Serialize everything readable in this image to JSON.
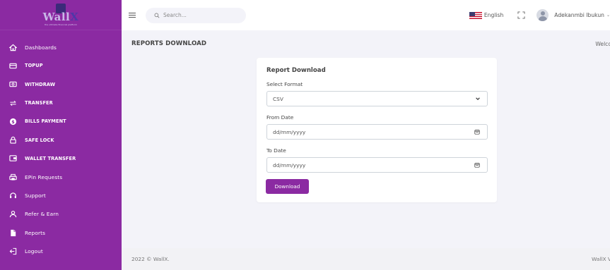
{
  "brand": {
    "logo_text_main": "Wall",
    "logo_text_accent": "X",
    "logo_tagline": "the ultimate financial platform"
  },
  "sidebar": {
    "items": [
      {
        "label": "Dashboards",
        "icon": "home-icon",
        "style": "normal"
      },
      {
        "label": "TOPUP",
        "icon": "card-icon",
        "style": "upper"
      },
      {
        "label": "WITHDRAW",
        "icon": "cash-icon",
        "style": "upper"
      },
      {
        "label": "TRANSFER",
        "icon": "arrows-icon",
        "style": "upper"
      },
      {
        "label": "BILLS PAYMENT",
        "icon": "dollar-circle-icon",
        "style": "upper"
      },
      {
        "label": "SAFE LOCK",
        "icon": "lock-icon",
        "style": "upper"
      },
      {
        "label": "WALLET TRANSFER",
        "icon": "wallet-icon",
        "style": "upper"
      },
      {
        "label": "EPin Requests",
        "icon": "printer-icon",
        "style": "normal"
      },
      {
        "label": "Support",
        "icon": "headset-icon",
        "style": "normal"
      },
      {
        "label": "Refer & Earn",
        "icon": "user-icon",
        "style": "normal"
      },
      {
        "label": "Reports",
        "icon": "document-icon",
        "style": "normal"
      },
      {
        "label": "Logout",
        "icon": "logout-icon",
        "style": "normal"
      }
    ]
  },
  "topbar": {
    "search_placeholder": "Search...",
    "language": "English",
    "user_name": "Adekanmbi Ibukun",
    "user_chevron": "⌄"
  },
  "page": {
    "title": "REPORTS DOWNLOAD",
    "welcome": "Welco"
  },
  "report": {
    "card_title": "Report Download",
    "format_label": "Select Format",
    "format_value": "CSV",
    "from_label": "From Date",
    "from_value": "dd/mm/yyyy",
    "to_label": "To Date",
    "to_value": "dd/mm/yyyy",
    "download_label": "Download"
  },
  "footer": {
    "copyright": "2022 © WallX.",
    "right": "WallX V"
  },
  "colors": {
    "sidebar_bg": "#8b2aa2",
    "accent": "#8b2aa2",
    "page_bg": "#f3f3f9"
  }
}
